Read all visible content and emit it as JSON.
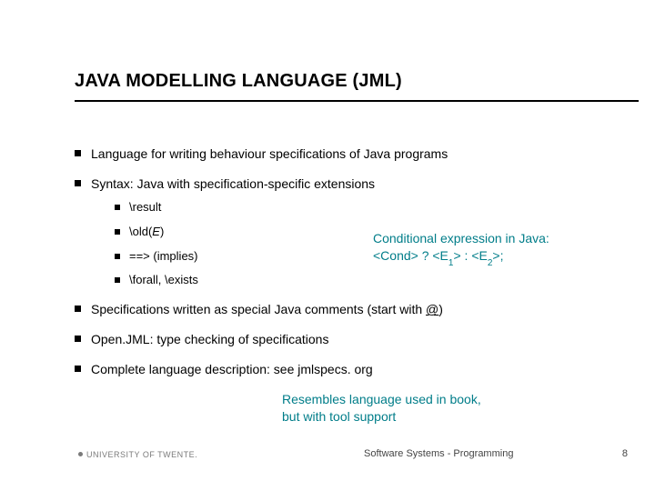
{
  "title": "JAVA MODELLING LANGUAGE (JML)",
  "bullets": {
    "b1": "Language for writing behaviour specifications of Java programs",
    "b2": "Syntax: Java with specification-specific extensions",
    "b2a": "\\result",
    "b2b_pre": "\\old(",
    "b2b_em": "E",
    "b2b_post": ")",
    "b2c": "==> (implies)",
    "b2d": "\\forall, \\exists",
    "b3_pre": "Specifications written as special Java comments (start with ",
    "b3_u": "@",
    "b3_post": ")",
    "b4": "Open.JML: type checking of specifications",
    "b5": "Complete language description: see jmlspecs. org"
  },
  "callout_right": {
    "line1": "Conditional expression in Java:",
    "line2_a": "<Cond> ? <E",
    "line2_s1": "1",
    "line2_b": "> : <E",
    "line2_s2": "2",
    "line2_c": ">;"
  },
  "callout_bottom": {
    "line1": "Resembles language used in book,",
    "line2": "but with tool support"
  },
  "footer": {
    "uni": "UNIVERSITY OF TWENTE.",
    "center": "Software Systems - Programming",
    "page": "8"
  }
}
